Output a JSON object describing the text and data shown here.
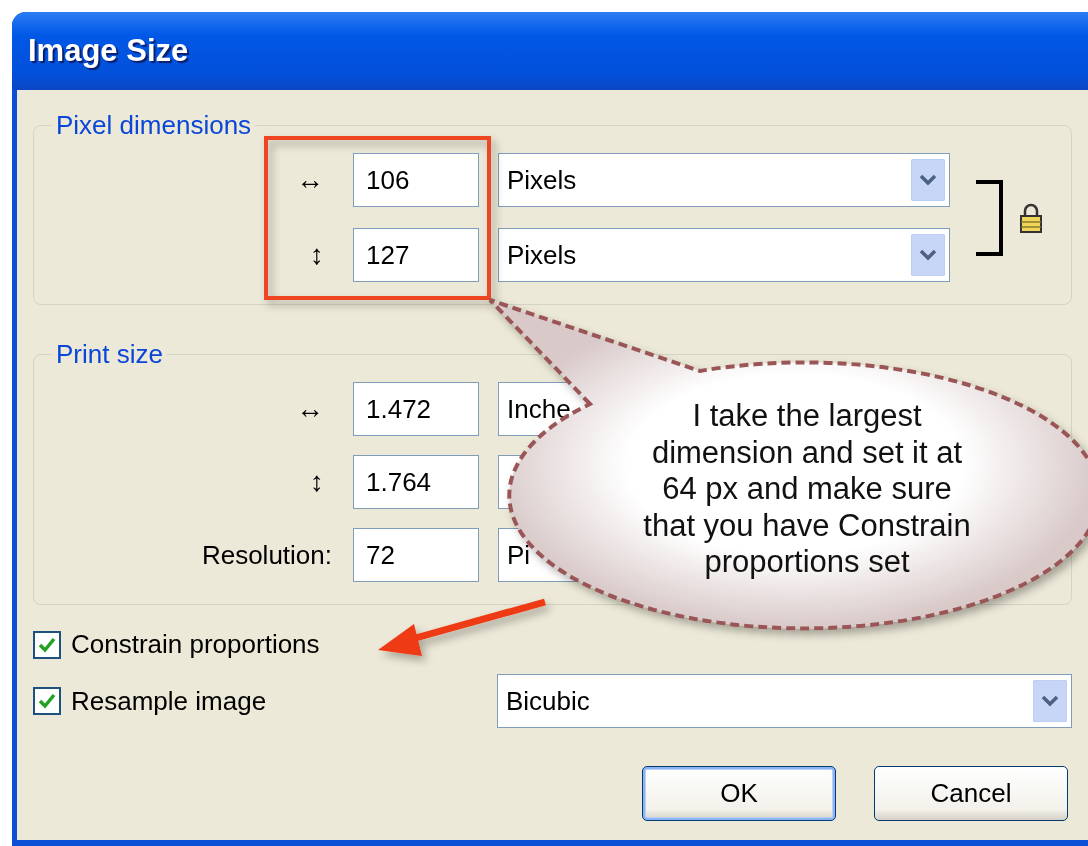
{
  "window": {
    "title": "Image Size"
  },
  "pixel_dimensions": {
    "legend": "Pixel dimensions",
    "linked": true,
    "rows": [
      {
        "label": "↔",
        "value": "106",
        "unit": "Pixels"
      },
      {
        "label": "↕",
        "value": "127",
        "unit": "Pixels"
      }
    ]
  },
  "print_size": {
    "legend": "Print size",
    "rows": [
      {
        "label": "↔",
        "value": "1.472",
        "unit": "Inche"
      },
      {
        "label": "↕",
        "value": "1.764"
      },
      {
        "label": "Resolution:",
        "value": "72",
        "unit": "Pi"
      }
    ]
  },
  "options": [
    {
      "label": "Constrain proportions",
      "checked": true
    },
    {
      "label": "Resample image",
      "checked": true
    }
  ],
  "resample_method": "Bicubic",
  "buttons": [
    {
      "label": "OK",
      "default": true
    },
    {
      "label": "Cancel",
      "default": false
    }
  ],
  "callout": {
    "text": "I take the largest dimension and set it at 64 px and make sure that you have Constrain proportions set"
  }
}
